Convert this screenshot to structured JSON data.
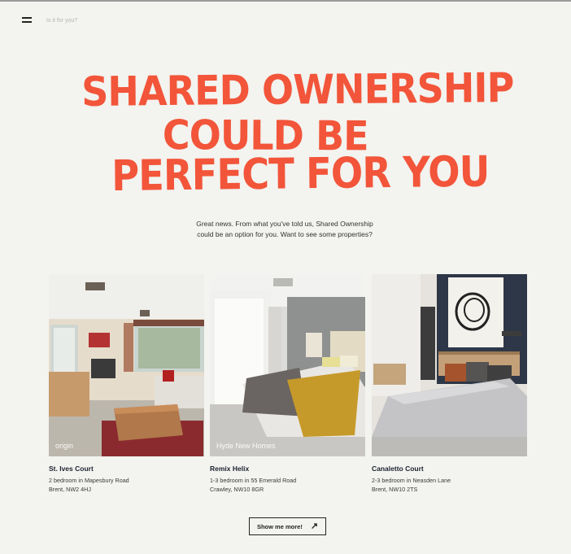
{
  "nav": {
    "menu_icon": "hamburger-icon",
    "link": "Is it for you?"
  },
  "headline": {
    "line1": "SHARED OWNERSHIP",
    "line2": "COULD BE",
    "line3": "PERFECT FOR YOU"
  },
  "intro": "Great news. From what you've told us, Shared Ownership could be an option for you. Want to see some properties?",
  "properties": [
    {
      "name": "St. Ives Court",
      "line1": "2 bedroom in Mapesbury Road",
      "line2": "Brent, NW2 4HJ",
      "logo": "origin"
    },
    {
      "name": "Remix Helix",
      "line1": "1-3 bedroom in 55 Emerald Road",
      "line2": "Crawley, NW10 8GR",
      "logo": "Hyde New Homes"
    },
    {
      "name": "Canaletto Court",
      "line1": "2-3 bedroom in Neasden Lane",
      "line2": "Brent, NW10 2TS",
      "logo": ""
    }
  ],
  "cta": {
    "label": "Show me more!",
    "icon": "arrow-up-right-icon"
  },
  "colors": {
    "accent": "#f2553a",
    "background": "#f3f3ef",
    "text": "#1c2230"
  }
}
